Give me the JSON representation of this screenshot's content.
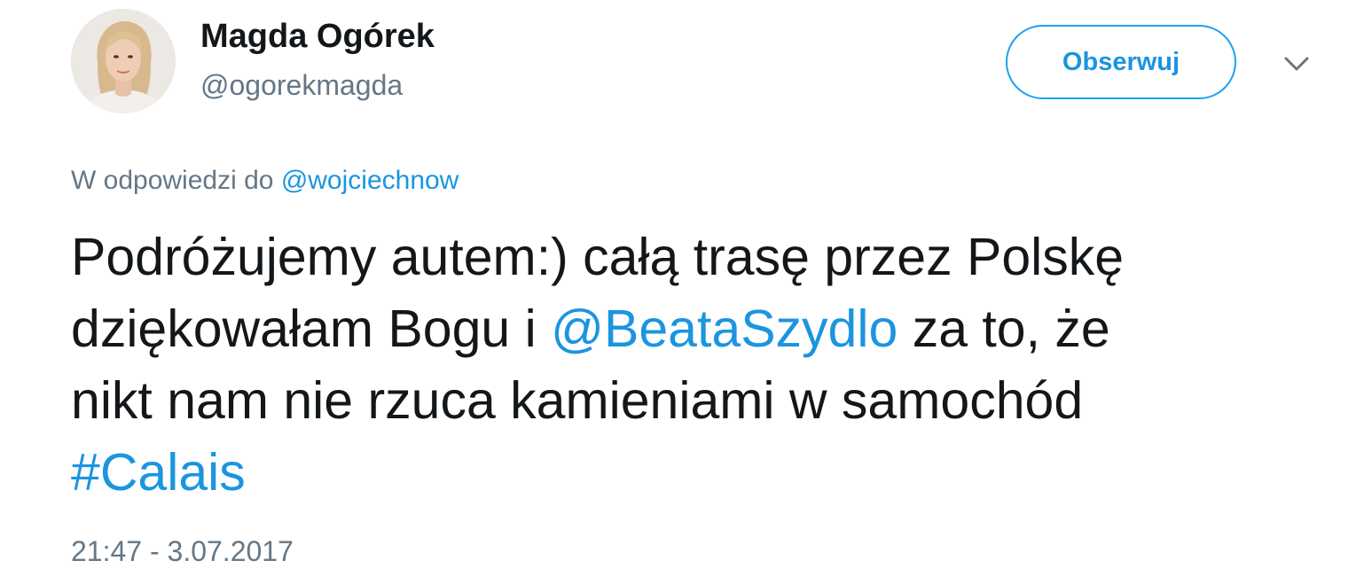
{
  "author": {
    "name": "Magda Ogórek",
    "handle": "@ogorekmagda"
  },
  "actions": {
    "follow_label": "Obserwuj",
    "more_icon": "chevron-down-icon"
  },
  "reply": {
    "prefix": "W odpowiedzi do",
    "mention": "@wojciechnow"
  },
  "tweet": {
    "line1": "Podróżujemy autem:) całą trasę przez Polskę",
    "line2_start": "dziękowałam Bogu i ",
    "line2_mention": "@BeataSzydlo",
    "line2_end": " za to, że",
    "line3": "nikt nam nie rzuca kamieniami w samochód",
    "hashtag": "#Calais"
  },
  "meta": {
    "timestamp": "21:47 - 3.07.2017"
  },
  "colors": {
    "link": "#1b95e0",
    "secondary_text": "#657786",
    "primary_text": "#14171a",
    "follow_border": "#1da1f2"
  }
}
